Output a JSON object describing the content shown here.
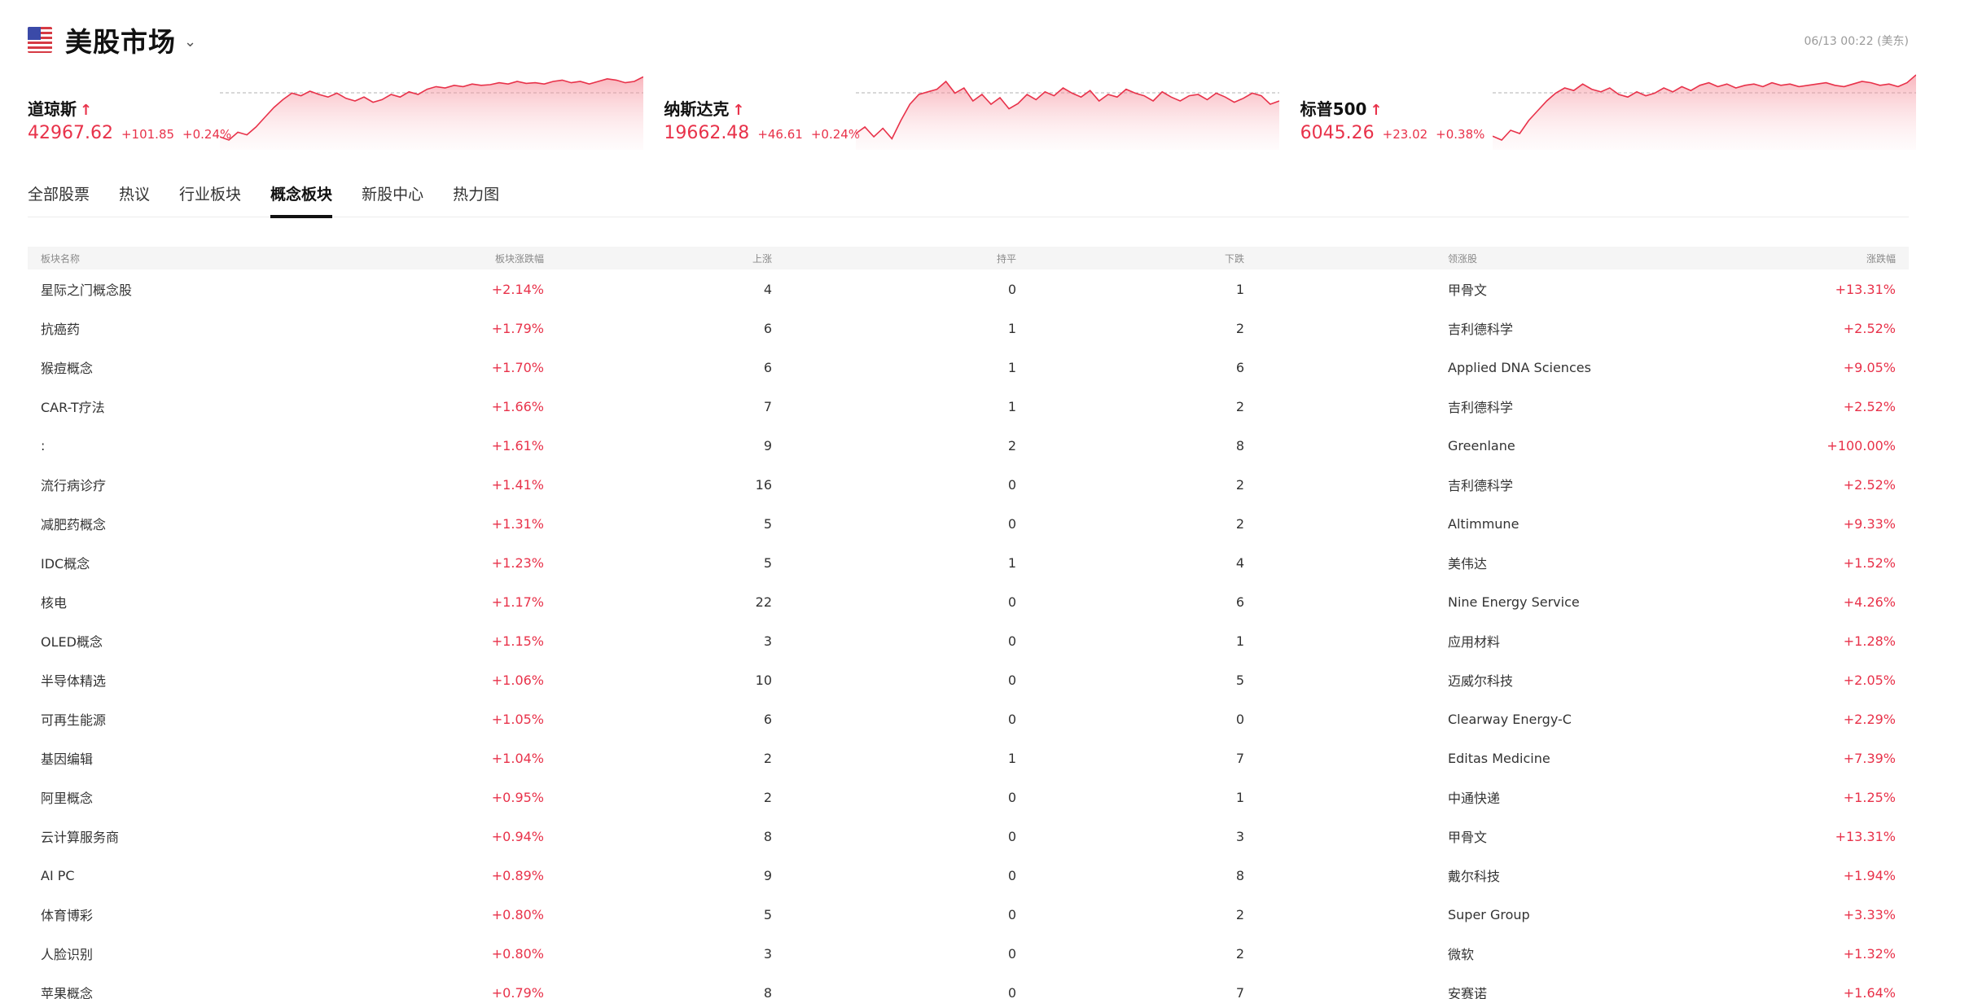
{
  "market": {
    "title": "美股市场",
    "timestamp": "06/13 00:22 (美东)"
  },
  "indices": [
    {
      "name": "道琼斯",
      "value": "42967.62",
      "change": "+101.85",
      "pct": "+0.24%",
      "spark": [
        0.05,
        0.0,
        0.12,
        0.08,
        0.2,
        0.35,
        0.5,
        0.62,
        0.72,
        0.68,
        0.75,
        0.7,
        0.66,
        0.72,
        0.64,
        0.6,
        0.66,
        0.58,
        0.62,
        0.7,
        0.66,
        0.74,
        0.7,
        0.78,
        0.82,
        0.8,
        0.84,
        0.82,
        0.86,
        0.84,
        0.85,
        0.88,
        0.86,
        0.9,
        0.87,
        0.88,
        0.86,
        0.9,
        0.92,
        0.88,
        0.9,
        0.86,
        0.9,
        0.94,
        0.92,
        0.88,
        0.9,
        0.97
      ]
    },
    {
      "name": "纳斯达克",
      "value": "19662.48",
      "change": "+46.61",
      "pct": "+0.24%",
      "spark": [
        0.1,
        0.2,
        0.05,
        0.18,
        0.02,
        0.3,
        0.55,
        0.7,
        0.74,
        0.78,
        0.9,
        0.72,
        0.8,
        0.6,
        0.7,
        0.55,
        0.65,
        0.48,
        0.56,
        0.7,
        0.62,
        0.74,
        0.68,
        0.8,
        0.72,
        0.66,
        0.76,
        0.6,
        0.7,
        0.66,
        0.78,
        0.72,
        0.68,
        0.6,
        0.74,
        0.66,
        0.6,
        0.68,
        0.7,
        0.62,
        0.72,
        0.66,
        0.58,
        0.64,
        0.72,
        0.68,
        0.55,
        0.6
      ]
    },
    {
      "name": "标普500",
      "value": "6045.26",
      "change": "+23.02",
      "pct": "+0.38%",
      "spark": [
        0.06,
        0.0,
        0.15,
        0.1,
        0.3,
        0.45,
        0.6,
        0.72,
        0.8,
        0.76,
        0.86,
        0.78,
        0.74,
        0.8,
        0.7,
        0.66,
        0.74,
        0.68,
        0.72,
        0.8,
        0.74,
        0.82,
        0.76,
        0.84,
        0.88,
        0.82,
        0.86,
        0.8,
        0.84,
        0.86,
        0.82,
        0.88,
        0.84,
        0.86,
        0.82,
        0.84,
        0.86,
        0.88,
        0.84,
        0.82,
        0.86,
        0.9,
        0.88,
        0.84,
        0.86,
        0.82,
        0.88,
        1.0
      ]
    }
  ],
  "tabs": [
    "全部股票",
    "热议",
    "行业板块",
    "概念板块",
    "新股中心",
    "热力图"
  ],
  "table": {
    "headers": [
      "板块名称",
      "板块涨跌幅",
      "上涨",
      "持平",
      "下跌",
      "领涨股",
      "涨跌幅"
    ],
    "rows": [
      [
        "星际之门概念股",
        "+2.14%",
        "4",
        "0",
        "1",
        "甲骨文",
        "+13.31%"
      ],
      [
        "抗癌药",
        "+1.79%",
        "6",
        "1",
        "2",
        "吉利德科学",
        "+2.52%"
      ],
      [
        "猴痘概念",
        "+1.70%",
        "6",
        "1",
        "6",
        "Applied DNA Sciences",
        "+9.05%"
      ],
      [
        "CAR-T疗法",
        "+1.66%",
        "7",
        "1",
        "2",
        "吉利德科学",
        "+2.52%"
      ],
      [
        ":",
        "+1.61%",
        "9",
        "2",
        "8",
        "Greenlane",
        "+100.00%"
      ],
      [
        "流行病诊疗",
        "+1.41%",
        "16",
        "0",
        "2",
        "吉利德科学",
        "+2.52%"
      ],
      [
        "减肥药概念",
        "+1.31%",
        "5",
        "0",
        "2",
        "Altimmune",
        "+9.33%"
      ],
      [
        "IDC概念",
        "+1.23%",
        "5",
        "1",
        "4",
        "美伟达",
        "+1.52%"
      ],
      [
        "核电",
        "+1.17%",
        "22",
        "0",
        "6",
        "Nine Energy Service",
        "+4.26%"
      ],
      [
        "OLED概念",
        "+1.15%",
        "3",
        "0",
        "1",
        "应用材料",
        "+1.28%"
      ],
      [
        "半导体精选",
        "+1.06%",
        "10",
        "0",
        "5",
        "迈威尔科技",
        "+2.05%"
      ],
      [
        "可再生能源",
        "+1.05%",
        "6",
        "0",
        "0",
        "Clearway Energy-C",
        "+2.29%"
      ],
      [
        "基因编辑",
        "+1.04%",
        "2",
        "1",
        "7",
        "Editas Medicine",
        "+7.39%"
      ],
      [
        "阿里概念",
        "+0.95%",
        "2",
        "0",
        "1",
        "中通快递",
        "+1.25%"
      ],
      [
        "云计算服务商",
        "+0.94%",
        "8",
        "0",
        "3",
        "甲骨文",
        "+13.31%"
      ],
      [
        "AI PC",
        "+0.89%",
        "9",
        "0",
        "8",
        "戴尔科技",
        "+1.94%"
      ],
      [
        "体育博彩",
        "+0.80%",
        "5",
        "0",
        "2",
        "Super Group",
        "+3.33%"
      ],
      [
        "人脸识别",
        "+0.80%",
        "3",
        "0",
        "2",
        "微软",
        "+1.32%"
      ],
      [
        "苹果概念",
        "+0.79%",
        "8",
        "0",
        "7",
        "安赛诺",
        "+1.64%"
      ]
    ]
  },
  "colors": {
    "up": "#e8324a",
    "text": "#333333",
    "muted": "#9a9a9a"
  }
}
